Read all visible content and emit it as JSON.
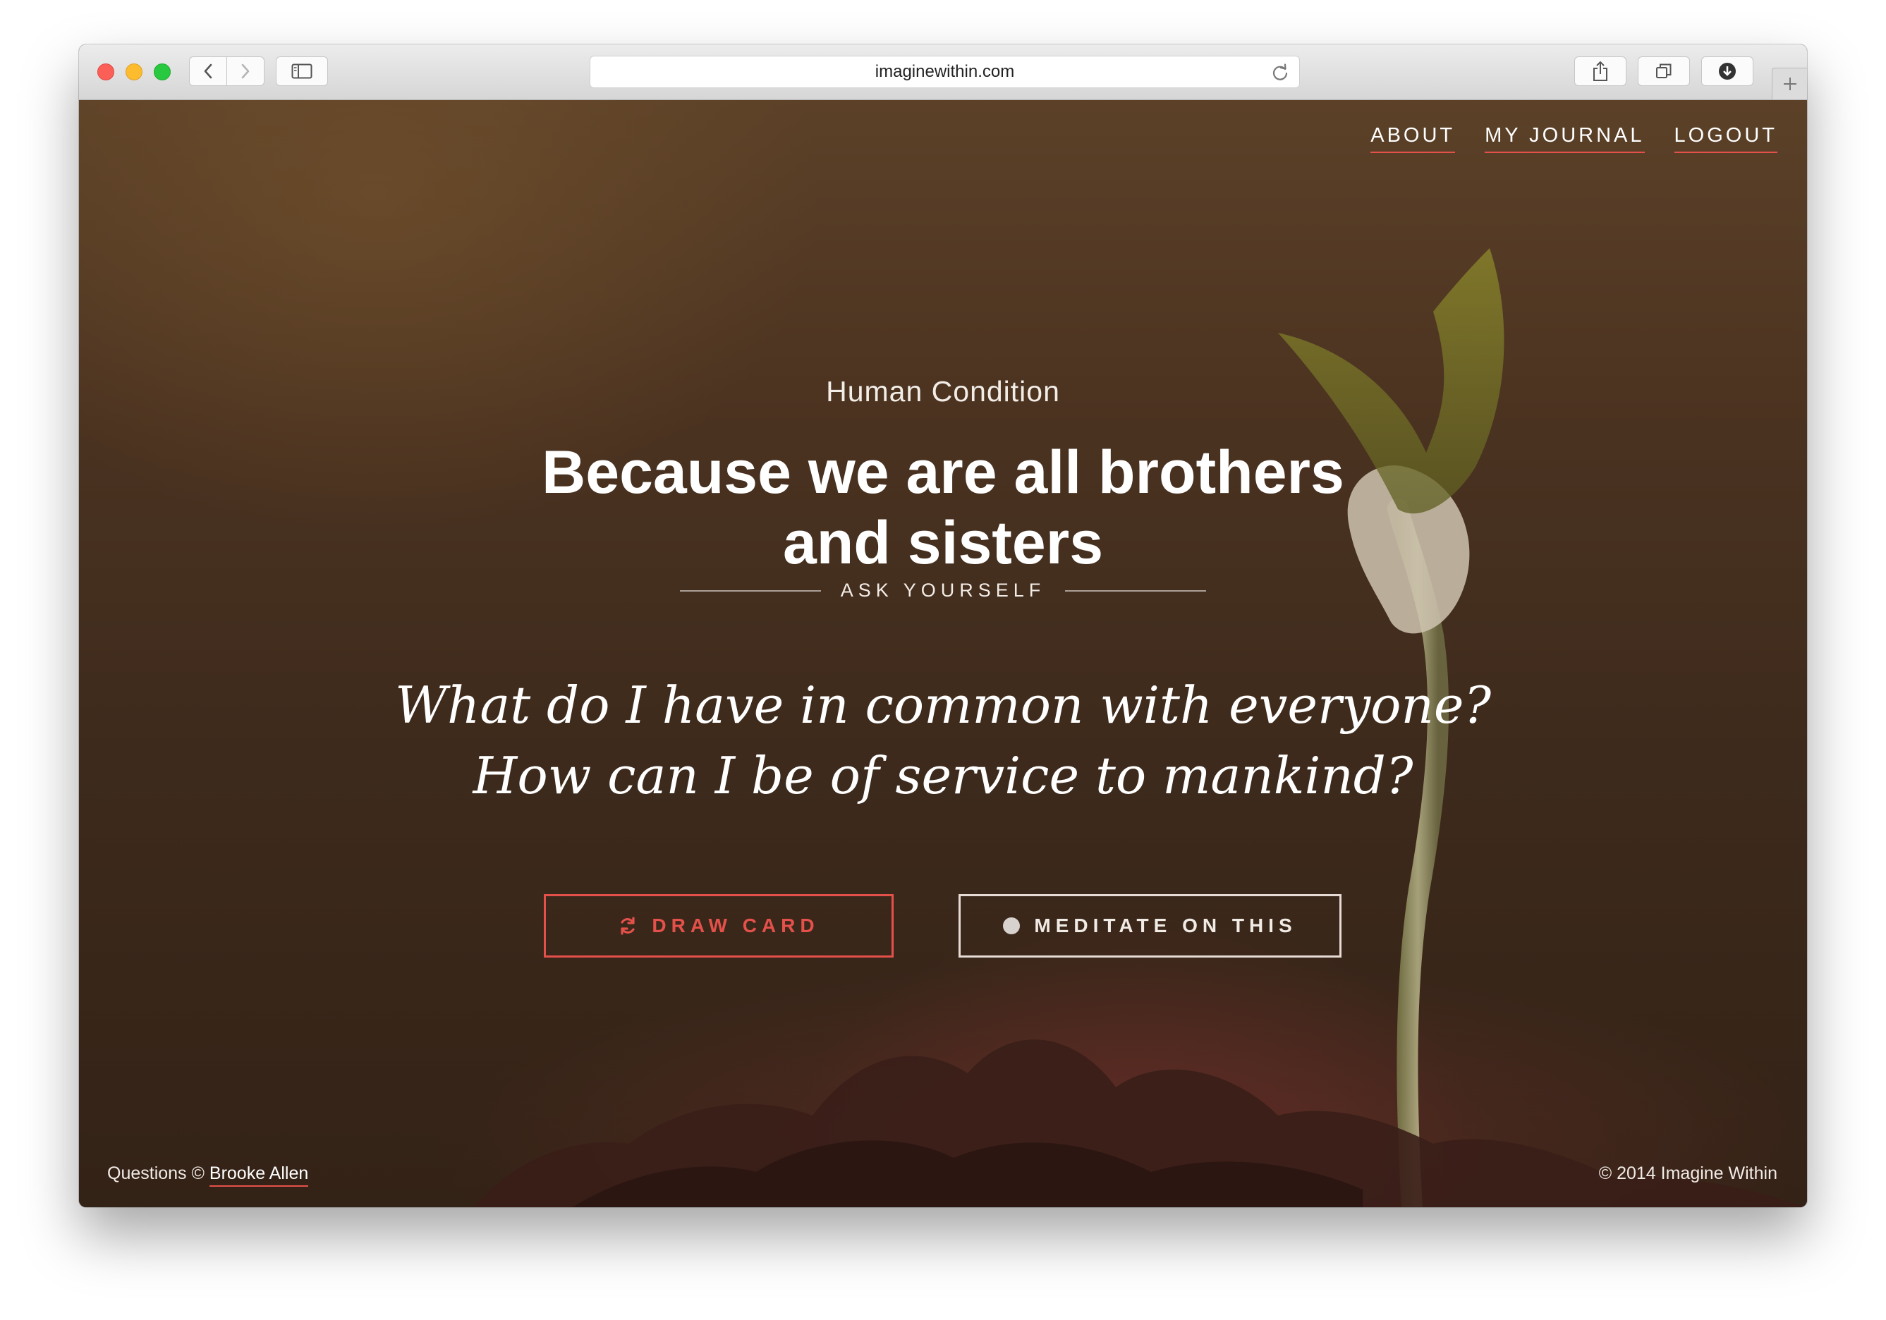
{
  "browser": {
    "url": "imaginewithin.com"
  },
  "nav": {
    "items": [
      {
        "label": "ABOUT"
      },
      {
        "label": "MY JOURNAL"
      },
      {
        "label": "LOGOUT"
      }
    ]
  },
  "card": {
    "category": "Human Condition",
    "headline": "Because we are all brothers and sisters",
    "ask_label": "ASK YOURSELF",
    "question_line1": "What do I have in common with everyone?",
    "question_line2": "How can I be of service to mankind?"
  },
  "actions": {
    "draw_label": "DRAW CARD",
    "draw_icon": "refresh-icon",
    "meditate_label": "MEDITATE ON THIS",
    "meditate_icon": "dot-icon"
  },
  "footer": {
    "credit_prefix": "Questions ©",
    "credit_author": "Brooke Allen",
    "copyright": "© 2014 Imagine Within"
  },
  "colors": {
    "accent": "#e4514b",
    "background": "#4a3220"
  }
}
